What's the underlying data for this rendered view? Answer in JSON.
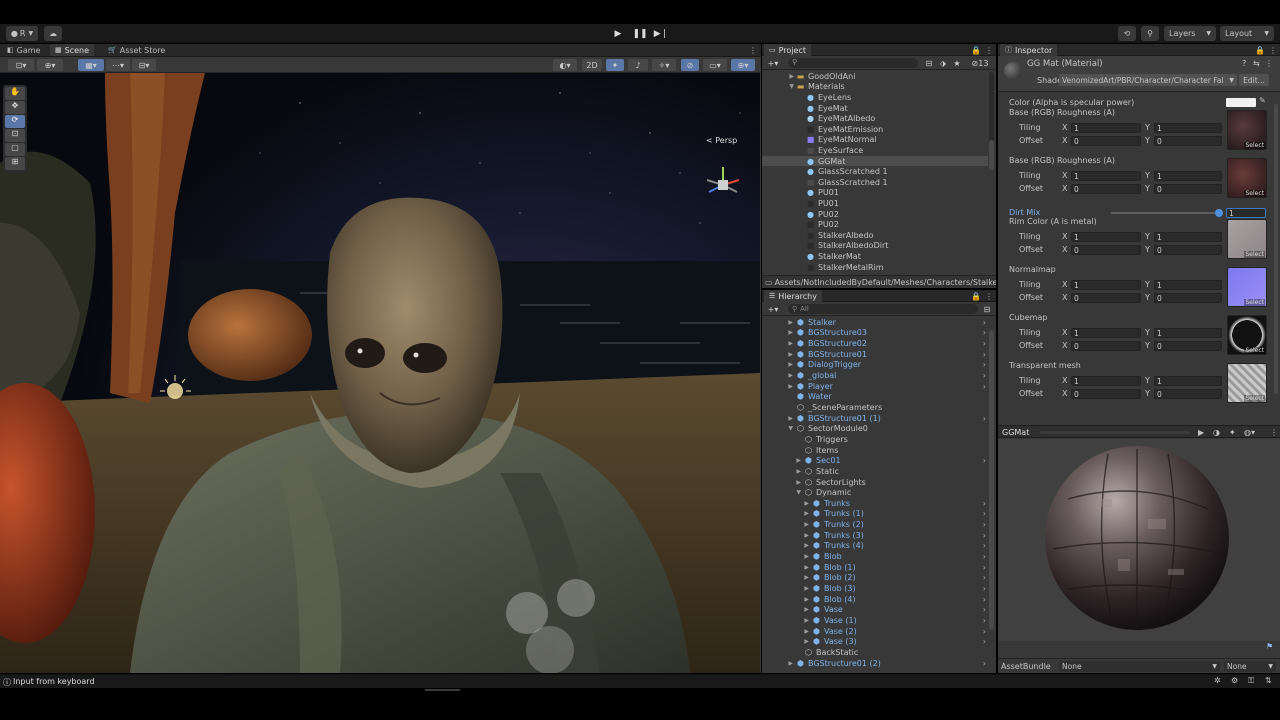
{
  "topbar": {
    "account": "R",
    "layers": "Layers",
    "layout": "Layout"
  },
  "scene_panel": {
    "tabs": [
      "Game",
      "Scene",
      "Asset Store"
    ],
    "toggle_2d": "2D",
    "gizmo_label": "Persp"
  },
  "project": {
    "tab": "Project",
    "hidden_count": "13",
    "items": [
      {
        "name": "GoodOldAni",
        "type": "folder",
        "indent": 2
      },
      {
        "name": "Materials",
        "type": "folder-open",
        "indent": 2
      },
      {
        "name": "EyeLens",
        "type": "mat",
        "indent": 3
      },
      {
        "name": "EyeMat",
        "type": "mat",
        "indent": 3
      },
      {
        "name": "EyeMatAlbedo",
        "type": "tex",
        "indent": 3
      },
      {
        "name": "EyeMatEmission",
        "type": "tex-dark",
        "indent": 3
      },
      {
        "name": "EyeMatNormal",
        "type": "tex-purple",
        "indent": 3
      },
      {
        "name": "EyeSurface",
        "type": "tex-gray",
        "indent": 3
      },
      {
        "name": "GGMat",
        "type": "mat",
        "indent": 3
      },
      {
        "name": "GlassScratched 1",
        "type": "mat",
        "indent": 3
      },
      {
        "name": "GlassScratched 1",
        "type": "tex-gray",
        "indent": 3
      },
      {
        "name": "PU01",
        "type": "mat",
        "indent": 3
      },
      {
        "name": "PU01",
        "type": "tex-dark",
        "indent": 3
      },
      {
        "name": "PU02",
        "type": "mat",
        "indent": 3
      },
      {
        "name": "PU02",
        "type": "tex-dark",
        "indent": 3
      },
      {
        "name": "StalkerAlbedo",
        "type": "tex-dark",
        "indent": 3
      },
      {
        "name": "StalkerAlbedoDirt",
        "type": "tex-dark",
        "indent": 3
      },
      {
        "name": "StalkerMat",
        "type": "mat",
        "indent": 3
      },
      {
        "name": "StalkerMetalRim",
        "type": "tex-dark",
        "indent": 3
      }
    ],
    "selected_index": 8,
    "path": "Assets/NotIncludedByDefault/Meshes/Characters/Stalker/"
  },
  "hierarchy": {
    "tab": "Hierarchy",
    "search_placeholder": "All",
    "items": [
      {
        "name": "Stalker",
        "icon": "prefab",
        "indent": 1,
        "arrow": "▶",
        "more": true
      },
      {
        "name": "BGStructure03",
        "icon": "prefab",
        "indent": 1,
        "arrow": "▶",
        "more": true
      },
      {
        "name": "BGStructure02",
        "icon": "prefab",
        "indent": 1,
        "arrow": "▶",
        "more": true
      },
      {
        "name": "BGStructure01",
        "icon": "prefab",
        "indent": 1,
        "arrow": "▶",
        "more": true
      },
      {
        "name": "DialogTrigger",
        "icon": "prefab",
        "indent": 1,
        "arrow": "▶",
        "more": true
      },
      {
        "name": "_global",
        "icon": "prefab",
        "indent": 1,
        "arrow": "▶",
        "more": true
      },
      {
        "name": "Player",
        "icon": "prefab",
        "indent": 1,
        "arrow": "▶",
        "more": true
      },
      {
        "name": "Water",
        "icon": "prefab",
        "indent": 1,
        "arrow": "",
        "more": false
      },
      {
        "name": "_SceneParameters",
        "icon": "go",
        "indent": 1,
        "arrow": "",
        "more": false
      },
      {
        "name": "BGStructure01 (1)",
        "icon": "prefab",
        "indent": 1,
        "arrow": "▶",
        "more": true
      },
      {
        "name": "SectorModule0",
        "icon": "go",
        "indent": 1,
        "arrow": "▼",
        "more": false
      },
      {
        "name": "Triggers",
        "icon": "go",
        "indent": 2,
        "arrow": "",
        "more": false
      },
      {
        "name": "Items",
        "icon": "go",
        "indent": 2,
        "arrow": "",
        "more": false
      },
      {
        "name": "Sec01",
        "icon": "prefab",
        "indent": 2,
        "arrow": "▶",
        "more": true
      },
      {
        "name": "Static",
        "icon": "go",
        "indent": 2,
        "arrow": "▶",
        "more": false
      },
      {
        "name": "SectorLights",
        "icon": "go",
        "indent": 2,
        "arrow": "▶",
        "more": false
      },
      {
        "name": "Dynamic",
        "icon": "go",
        "indent": 2,
        "arrow": "▼",
        "more": false
      },
      {
        "name": "Trunks",
        "icon": "prefab",
        "indent": 3,
        "arrow": "▶",
        "more": true
      },
      {
        "name": "Trunks (1)",
        "icon": "prefab",
        "indent": 3,
        "arrow": "▶",
        "more": true
      },
      {
        "name": "Trunks (2)",
        "icon": "prefab",
        "indent": 3,
        "arrow": "▶",
        "more": true
      },
      {
        "name": "Trunks (3)",
        "icon": "prefab",
        "indent": 3,
        "arrow": "▶",
        "more": true
      },
      {
        "name": "Trunks (4)",
        "icon": "prefab",
        "indent": 3,
        "arrow": "▶",
        "more": true
      },
      {
        "name": "Blob",
        "icon": "prefab",
        "indent": 3,
        "arrow": "▶",
        "more": true
      },
      {
        "name": "Blob (1)",
        "icon": "prefab",
        "indent": 3,
        "arrow": "▶",
        "more": true
      },
      {
        "name": "Blob (2)",
        "icon": "prefab",
        "indent": 3,
        "arrow": "▶",
        "more": true
      },
      {
        "name": "Blob (3)",
        "icon": "prefab",
        "indent": 3,
        "arrow": "▶",
        "more": true
      },
      {
        "name": "Blob (4)",
        "icon": "prefab",
        "indent": 3,
        "arrow": "▶",
        "more": true
      },
      {
        "name": "Vase",
        "icon": "prefab",
        "indent": 3,
        "arrow": "▶",
        "more": true
      },
      {
        "name": "Vase (1)",
        "icon": "prefab",
        "indent": 3,
        "arrow": "▶",
        "more": true
      },
      {
        "name": "Vase (2)",
        "icon": "prefab",
        "indent": 3,
        "arrow": "▶",
        "more": true
      },
      {
        "name": "Vase (3)",
        "icon": "prefab",
        "indent": 3,
        "arrow": "▶",
        "more": true
      },
      {
        "name": "BackStatic",
        "icon": "go",
        "indent": 2,
        "arrow": "",
        "more": false
      },
      {
        "name": "BGStructure01 (2)",
        "icon": "prefab",
        "indent": 1,
        "arrow": "▶",
        "more": true
      }
    ]
  },
  "inspector": {
    "tab": "Inspector",
    "material_title": "GG Mat (Material)",
    "shader_label": "Shader",
    "shader_value": "VenomizedArt/PBR/Character/Character Fal",
    "edit_label": "Edit...",
    "color_label": "Color (Alpha is specular power)",
    "tiling_label": "Tiling",
    "offset_label": "Offset",
    "x_label": "X",
    "y_label": "Y",
    "select_label": "Select",
    "sections": [
      {
        "label": "Base (RGB) Roughness (A)",
        "tiling": [
          "1",
          "1"
        ],
        "offset": [
          "0",
          "0"
        ],
        "thumb": "dark-red"
      },
      {
        "label": "Base (RGB) Roughness (A)",
        "tiling": [
          "1",
          "1"
        ],
        "offset": [
          "0",
          "0"
        ],
        "thumb": "dark-brown"
      },
      {
        "label": "Rim Color (A is metal)",
        "tiling": [
          "1",
          "1"
        ],
        "offset": [
          "0",
          "0"
        ],
        "thumb": "gray"
      },
      {
        "label": "Normalmap",
        "tiling": [
          "1",
          "1"
        ],
        "offset": [
          "0",
          "0"
        ],
        "thumb": "normal"
      },
      {
        "label": "Cubemap",
        "tiling": [
          "1",
          "1"
        ],
        "offset": [
          "0",
          "0"
        ],
        "thumb": "cube"
      },
      {
        "label": "Transparent mesh",
        "tiling": [
          "1",
          "1"
        ],
        "offset": [
          "0",
          "0"
        ],
        "thumb": "noise"
      }
    ],
    "dirt_mix_label": "Dirt Mix",
    "dirt_mix_value": "1",
    "dirt_mix_fraction": 1.0,
    "preview_title": "GGMat",
    "assetbundle_label": "AssetBundle",
    "assetbundle_value": "None",
    "assetbundle_variant": "None"
  },
  "statusbar": {
    "message": "Input from keyboard"
  },
  "colors": {
    "panel_bg": "#383838",
    "header_bg": "#282828",
    "accent_blue": "#5b77a8",
    "prefab_blue": "#7fb3ea"
  }
}
